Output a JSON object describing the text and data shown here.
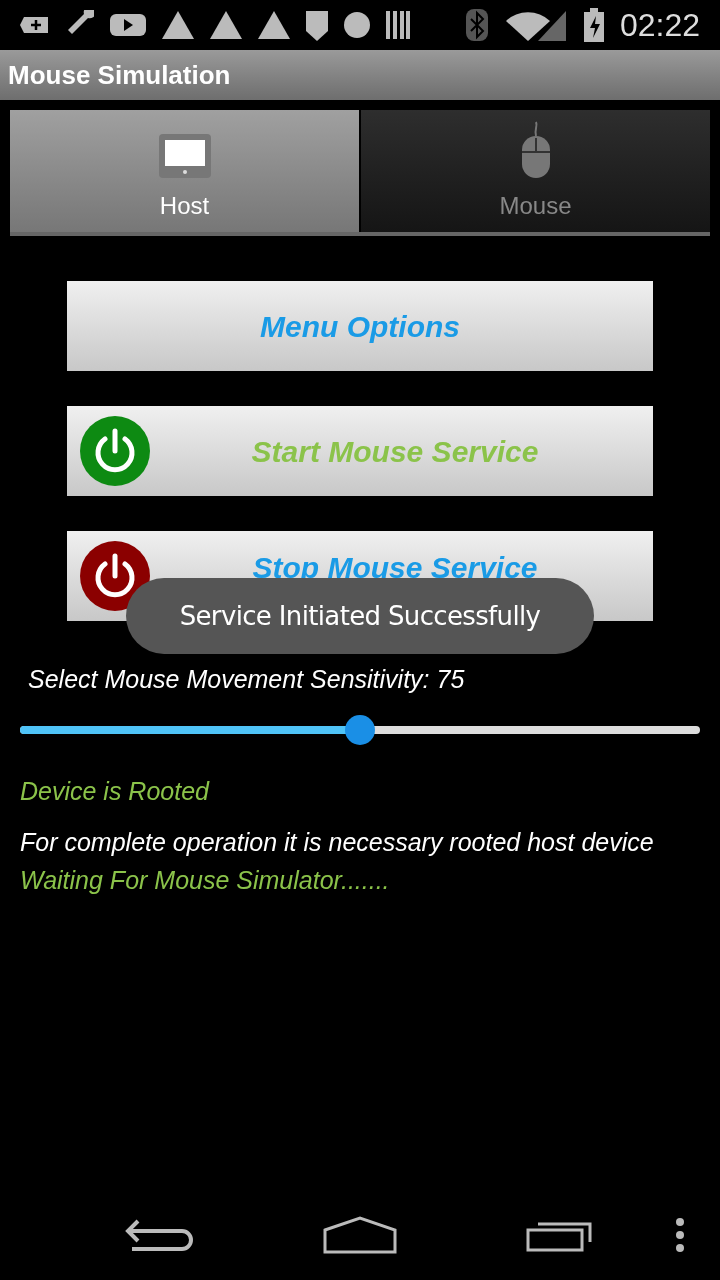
{
  "status_bar": {
    "time": "02:22"
  },
  "title": "Mouse Simulation",
  "tabs": [
    {
      "label": "Host",
      "selected": true,
      "kind": "monitor"
    },
    {
      "label": "Mouse",
      "selected": false,
      "kind": "mouse"
    }
  ],
  "buttons": [
    {
      "label": "Menu Options",
      "kind": "plain"
    },
    {
      "label": "Start Mouse Service",
      "kind": "start"
    },
    {
      "label": "Stop Mouse Service",
      "kind": "stop"
    }
  ],
  "sensitivity": {
    "label": "Select Mouse Movement Sensitivity: 75",
    "level": 0.5
  },
  "messages": [
    {
      "text": "Device is Rooted",
      "color": "#8bc34a"
    },
    {
      "text": "For complete operation it is necessary rooted host device",
      "color": "#ffffff"
    },
    {
      "text": "Waiting For Mouse Simulator.......",
      "color": "#8bc34a"
    }
  ],
  "toast": {
    "text": "Service Initiated Successfully"
  }
}
